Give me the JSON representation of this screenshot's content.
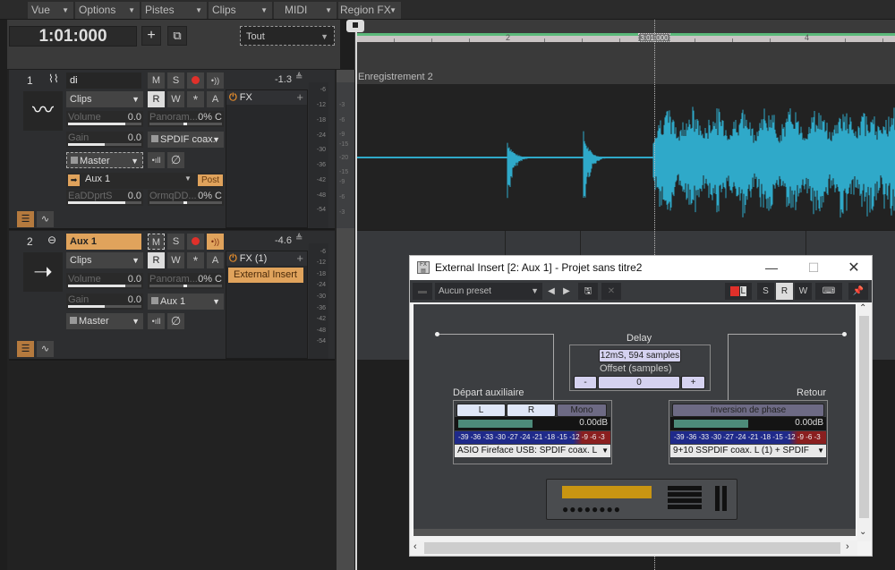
{
  "menubar": {
    "items": [
      {
        "label": "Vue"
      },
      {
        "label": "Options"
      },
      {
        "label": "Pistes"
      },
      {
        "label": "Clips"
      },
      {
        "label": "MIDI"
      },
      {
        "label": "Region FX"
      }
    ]
  },
  "toolbar": {
    "time": "1:01:000",
    "add_track_icon": "plus",
    "add_folder_icon": "plus-box",
    "filter_value": "Tout"
  },
  "ruler": {
    "marks": [
      "2",
      "3:01:000",
      "4"
    ],
    "now_time": "3:01:000"
  },
  "tracks": [
    {
      "number": "1",
      "type_icon": "audio-wave",
      "name": "di",
      "buttons": {
        "mute": "M",
        "solo": "S",
        "read": "R",
        "write": "W",
        "asterisk": "*",
        "archive": "A"
      },
      "input_mode": "Clips",
      "volume_label": "Volume",
      "volume_value": "0.0",
      "volume_fraction": 0.8,
      "pan_label": "Panoram...",
      "pan_value": "0% C",
      "gain_label": "Gain",
      "gain_value": "0.0",
      "gain_fraction": 0.5,
      "input_device": "SPDIF coax.",
      "output": "Master",
      "send": {
        "target": "Aux 1",
        "mode": "Post",
        "level_label": "EaDDprtS",
        "level_value": "0.0",
        "level_fraction": 0.8,
        "pan_label": "OrmqDD...",
        "pan_value": "0% C"
      },
      "fx_label": "FX",
      "peak": "-1.3",
      "meter_scale": [
        "-6",
        "-12",
        "-18",
        "-24",
        "-30",
        "-36",
        "-42",
        "-48",
        "-54"
      ],
      "clip_scale": [
        "-3",
        "-6",
        "-9",
        "-15",
        "-20",
        "-15",
        "-9",
        "-6",
        "-3"
      ]
    },
    {
      "number": "2",
      "type_icon": "aux-send",
      "name": "Aux 1",
      "buttons": {
        "mute": "M",
        "solo": "S",
        "read": "R",
        "write": "W",
        "asterisk": "*",
        "archive": "A"
      },
      "input_mode": "Clips",
      "volume_label": "Volume",
      "volume_value": "0.0",
      "volume_fraction": 0.8,
      "pan_label": "Panoram...",
      "pan_value": "0% C",
      "gain_label": "Gain",
      "gain_value": "0.0",
      "gain_fraction": 0.5,
      "input_device": "Aux 1",
      "output": "Master",
      "fx_label": "FX (1)",
      "fx_items": [
        "External Insert"
      ],
      "peak": "-4.6",
      "meter_scale": [
        "-6",
        "-12",
        "-18",
        "-24",
        "-30",
        "-36",
        "-42",
        "-48",
        "-54"
      ]
    }
  ],
  "clip": {
    "name": "Enregistrement 2"
  },
  "plugin": {
    "title": "External Insert [2: Aux 1] - Projet sans titre2",
    "preset": "Aucun preset",
    "toolbar": {
      "s": "S",
      "r": "R",
      "w": "W",
      "al": "L"
    },
    "delay": {
      "label": "Delay",
      "value": "12mS, 594 samples",
      "offset_label": "Offset (samples)",
      "minus": "-",
      "offset_value": "0",
      "plus": "+"
    },
    "send": {
      "label": "Départ auxiliaire",
      "btn_l": "L",
      "btn_r": "R",
      "btn_mono": "Mono",
      "level_db": "0.00dB",
      "level_fraction": 0.55,
      "scale": "-39 -36 -33 -30 -27 -24 -21 -18 -15 -12 -9  -6  -3",
      "device": "ASIO Fireface USB: SPDIF coax. L"
    },
    "return": {
      "label": "Retour",
      "phase": "Inversion de phase",
      "level_db": "0.00dB",
      "level_fraction": 0.55,
      "scale": "-39 -36 -33 -30 -27 -24 -21 -18 -15 -12 -9  -6  -3",
      "device": "9+10 SSPDIF coax. L (1) + SPDIF"
    }
  },
  "colors": {
    "accent_orange": "#e0a35c",
    "waveform": "#2fa9c9",
    "record_red": "#e0302a",
    "timeline_green": "#5bb97a",
    "device_display": "#c99512"
  }
}
